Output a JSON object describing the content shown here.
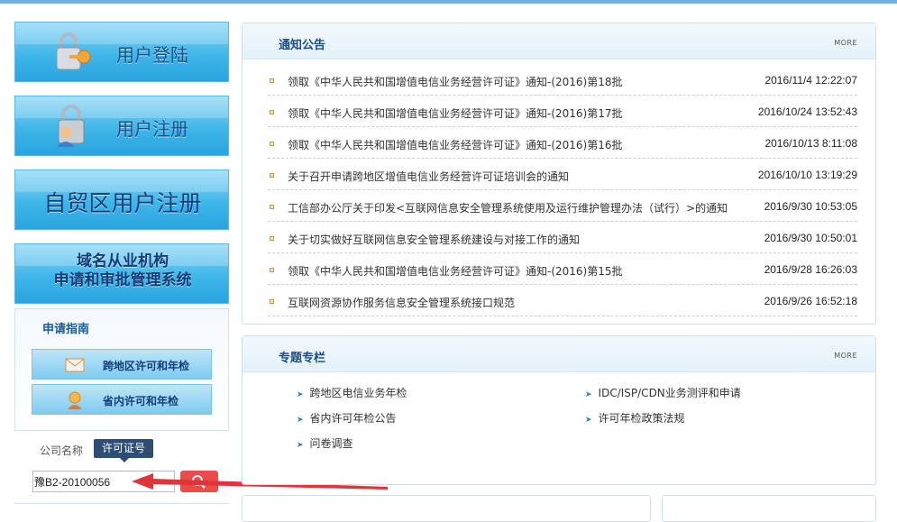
{
  "left": {
    "banners": [
      {
        "label": "用户登陆",
        "icon": "lock-key-icon"
      },
      {
        "label": "用户注册",
        "icon": "user-lock-icon"
      },
      {
        "label": "自贸区用户注册"
      },
      {
        "label_line1": "域名从业机构",
        "label_line2": "申请和审批管理系统"
      }
    ],
    "guide": {
      "title": "申请指南",
      "buttons": [
        {
          "label": "跨地区许可和年检",
          "icon": "envelope-icon"
        },
        {
          "label": "省内许可和年检",
          "icon": "person-icon"
        }
      ]
    },
    "search": {
      "tab_company": "公司名称",
      "tab_license": "许可证号",
      "value": "豫B2-20100056",
      "button_icon": "search-icon"
    }
  },
  "notice": {
    "title": "通知公告",
    "more": "MORE",
    "items": [
      {
        "title": "领取《中华人民共和国增值电信业务经营许可证》通知-(2016)第18批",
        "date": "2016/11/4 12:22:07"
      },
      {
        "title": "领取《中华人民共和国增值电信业务经营许可证》通知-(2016)第17批",
        "date": "2016/10/24 13:52:43"
      },
      {
        "title": "领取《中华人民共和国增值电信业务经营许可证》通知-(2016)第16批",
        "date": "2016/10/13 8:11:08"
      },
      {
        "title": "关于召开申请跨地区增值电信业务经营许可证培训会的通知",
        "date": "2016/10/10 13:19:29"
      },
      {
        "title": "工信部办公厅关于印发<互联网信息安全管理系统使用及运行维护管理办法（试行）>的通知",
        "date": "2016/9/30 10:53:05"
      },
      {
        "title": "关于切实做好互联网信息安全管理系统建设与对接工作的通知",
        "date": "2016/9/30 10:50:01"
      },
      {
        "title": "领取《中华人民共和国增值电信业务经营许可证》通知-(2016)第15批",
        "date": "2016/9/28 16:26:03"
      },
      {
        "title": "互联网资源协作服务信息安全管理系统接口规范",
        "date": "2016/9/26 16:52:18"
      }
    ]
  },
  "topics": {
    "title": "专题专栏",
    "more": "MORE",
    "items": [
      {
        "label": "跨地区电信业务年检"
      },
      {
        "label": "IDC/ISP/CDN业务测评和申请"
      },
      {
        "label": "省内许可年检公告"
      },
      {
        "label": "许可年检政策法规"
      },
      {
        "label": "问卷调查"
      }
    ]
  },
  "colors": {
    "accent": "#1c4e86",
    "arrow": "#e0333a",
    "search_button": "#ea4b4b"
  }
}
